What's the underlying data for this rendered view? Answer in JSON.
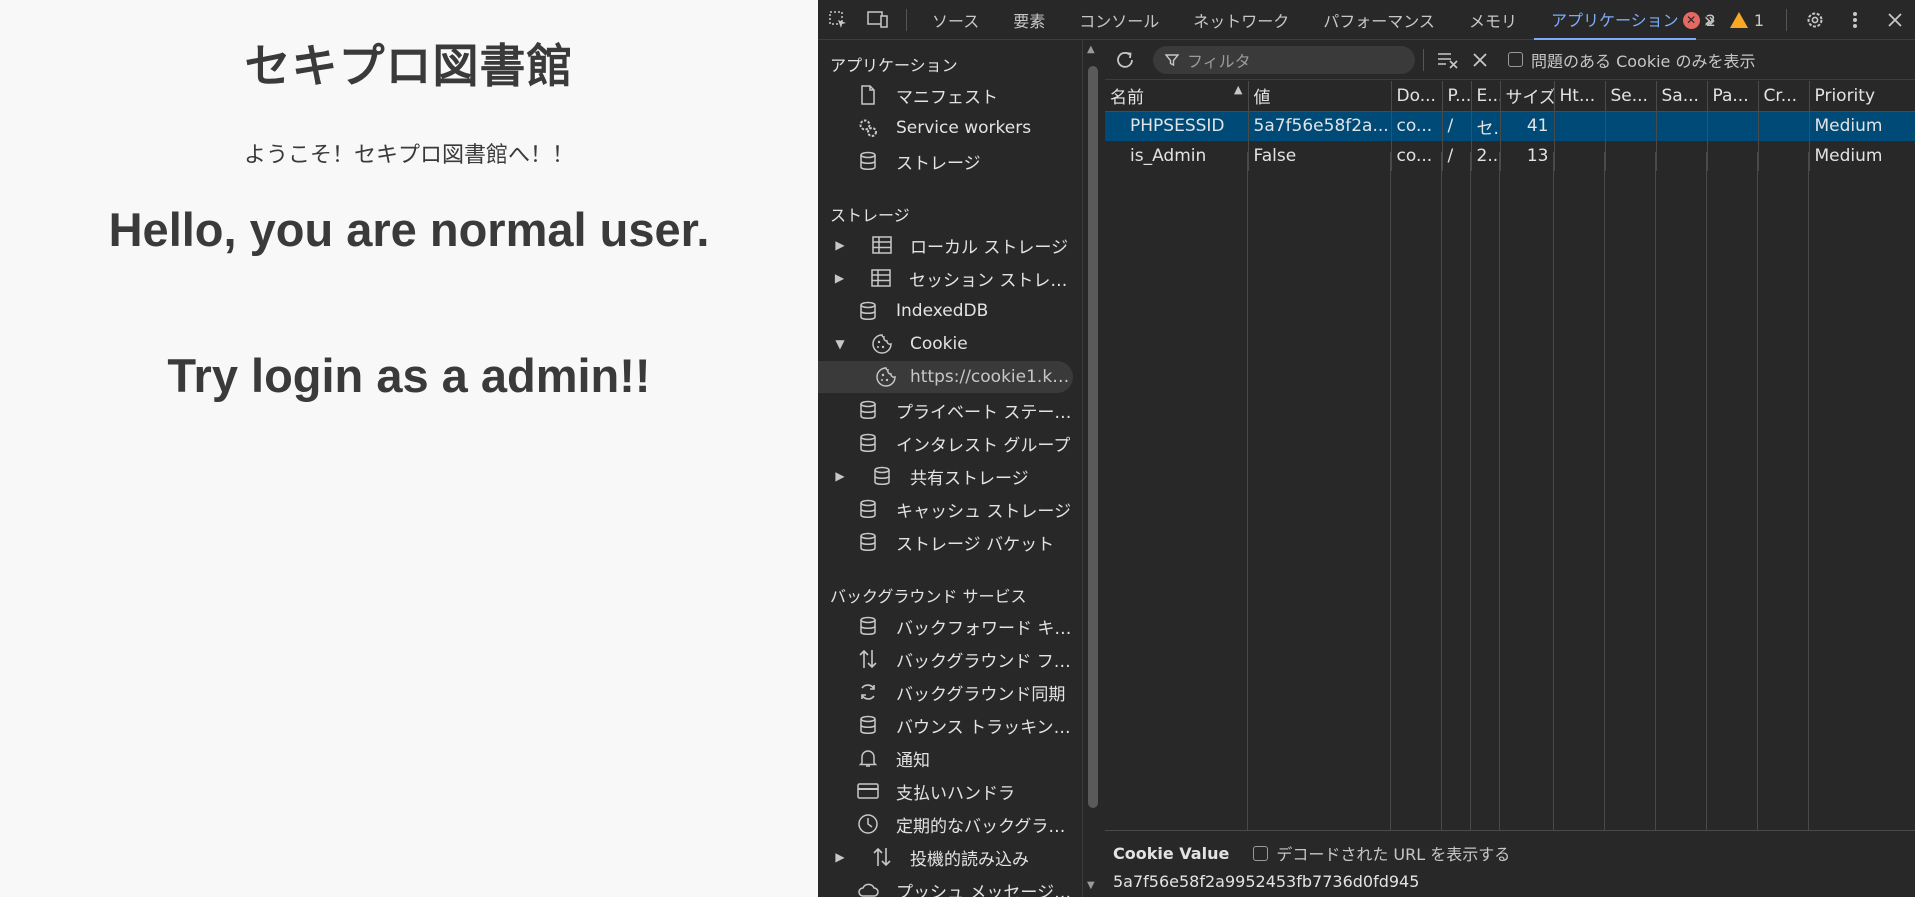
{
  "page": {
    "title": "セキプロ図書館",
    "welcome": "ようこそ！セキプロ図書館へ！！",
    "hello": "Hello, you are normal user.",
    "try": "Try login as a admin!!"
  },
  "devtools": {
    "tabs": [
      "ソース",
      "要素",
      "コンソール",
      "ネットワーク",
      "パフォーマンス",
      "メモリ",
      "アプリケーション"
    ],
    "active_tab": "アプリケーション",
    "more": "»",
    "errors": "2",
    "warnings": "1",
    "sidebar": {
      "app_section": "アプリケーション",
      "app_items": [
        "マニフェスト",
        "Service workers",
        "ストレージ"
      ],
      "storage_section": "ストレージ",
      "storage_items": [
        "ローカル ストレージ",
        "セッション ストレージ",
        "IndexedDB",
        "Cookie",
        "https://cookie1.ki...",
        "プライベート ステート ト...",
        "インタレスト グループ",
        "共有ストレージ",
        "キャッシュ ストレージ",
        "ストレージ バケット"
      ],
      "bg_section": "バックグラウンド サービス",
      "bg_items": [
        "バックフォワード キャッシュ",
        "バックグラウンド フェッチ",
        "バックグラウンド同期",
        "バウンス トラッキング対...",
        "通知",
        "支払いハンドラ",
        "定期的なバックグラウ...",
        "投機的読み込み",
        "プッシュ メッセージング"
      ]
    },
    "toolbar": {
      "filter_placeholder": "フィルタ",
      "only_issues": "問題のある Cookie のみを表示"
    },
    "table": {
      "headers": [
        "名前",
        "値",
        "Do...",
        "P...",
        "E...",
        "サイズ",
        "Ht...",
        "Se...",
        "Sa...",
        "Pa...",
        "Cr...",
        "Priority"
      ],
      "rows": [
        [
          "PHPSESSID",
          "5a7f56e58f2a...",
          "co...",
          "/",
          "セ...",
          "41",
          "",
          "",
          "",
          "",
          "",
          "Medium"
        ],
        [
          "is_Admin",
          "False",
          "co...",
          "/",
          "2...",
          "13",
          "",
          "",
          "",
          "",
          "",
          "Medium"
        ]
      ]
    },
    "cookie_value": {
      "label": "Cookie Value",
      "decode_option": "デコードされた URL を表示する",
      "value": "5a7f56e58f2a9952453fb7736d0fd945"
    }
  }
}
